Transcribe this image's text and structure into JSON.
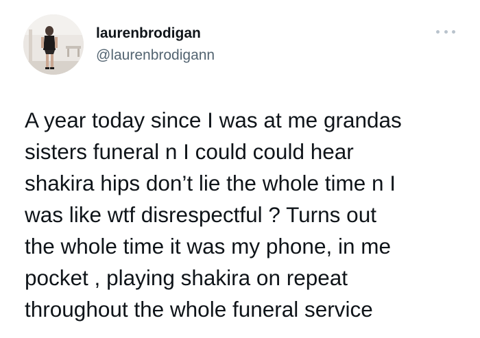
{
  "author": {
    "display_name": "laurenbrodigan",
    "handle": "@laurenbrodigann",
    "avatar_icon": "profile-photo"
  },
  "menu": {
    "icon": "more-options-icon"
  },
  "tweet": {
    "lines": [
      "A year today since I was at me grandas",
      "sisters funeral n I could could hear",
      "shakira hips don’t lie the whole time n I",
      "was like wtf disrespectful ? Turns out",
      "the whole time it was my phone, in me",
      "pocket , playing shakira on repeat",
      "throughout the whole funeral service"
    ]
  },
  "colors": {
    "text_primary": "#0f1419",
    "text_secondary": "#536471",
    "menu_dots": "#b9c3cc",
    "background": "#ffffff"
  }
}
